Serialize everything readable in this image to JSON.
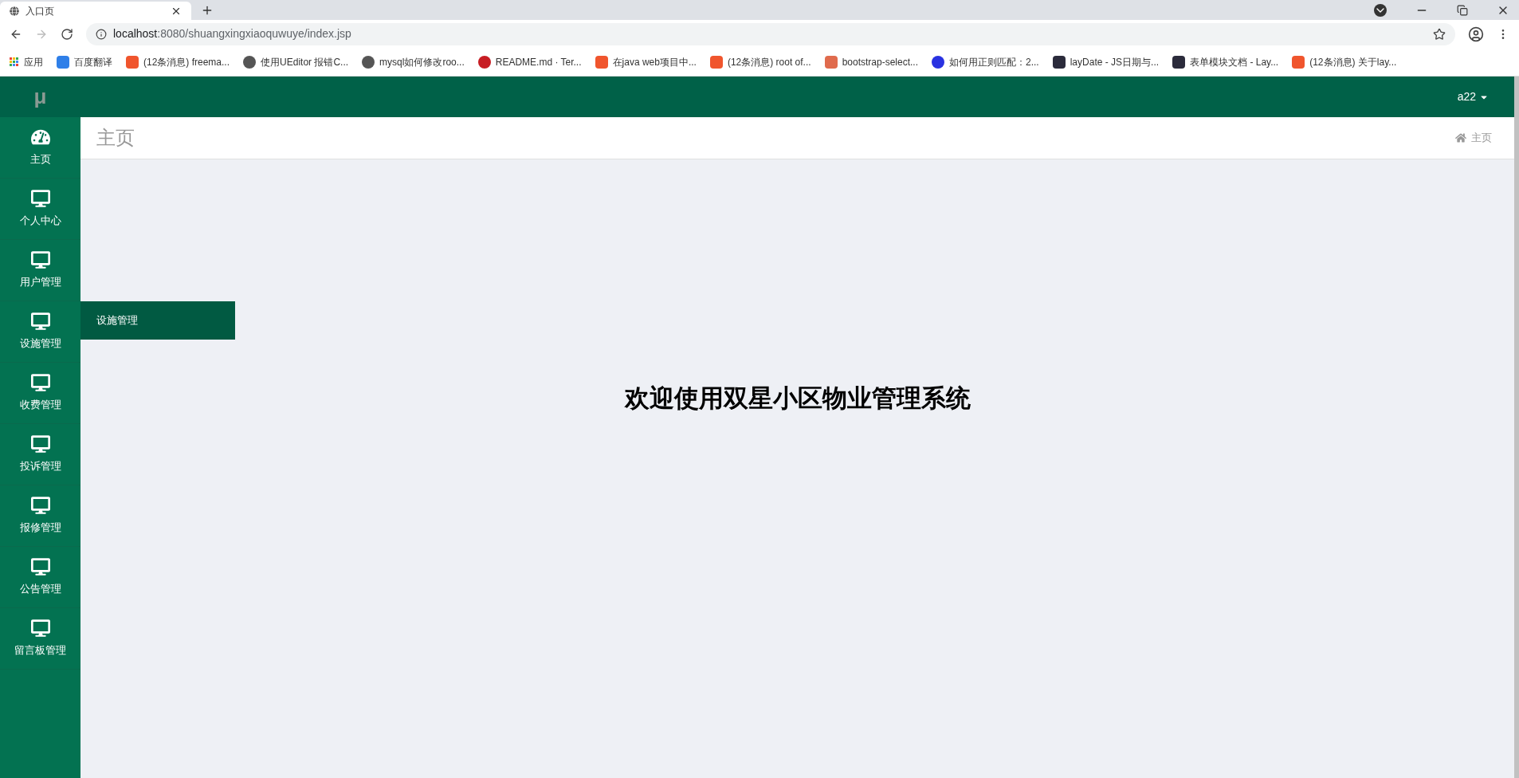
{
  "browser": {
    "tabs": [
      {
        "title": "入口页",
        "selected": true
      }
    ],
    "url_host": "localhost",
    "url_rest": ":8080/shuangxingxiaoquwuye/index.jsp",
    "bookmarks": [
      {
        "label": "应用",
        "kind": "apps"
      },
      {
        "label": "百度翻译",
        "kind": "translate"
      },
      {
        "label": "(12条消息) freema...",
        "kind": "csdn"
      },
      {
        "label": "使用UEditor 报错C...",
        "kind": "plain"
      },
      {
        "label": "mysql如何修改roo...",
        "kind": "plain"
      },
      {
        "label": "README.md · Ter...",
        "kind": "gitee"
      },
      {
        "label": "在java web项目中...",
        "kind": "csdn"
      },
      {
        "label": "(12条消息) root of...",
        "kind": "csdn"
      },
      {
        "label": "bootstrap-select...",
        "kind": "jianshu"
      },
      {
        "label": "如何用正则匹配：2...",
        "kind": "baidu"
      },
      {
        "label": "layDate - JS日期与...",
        "kind": "layui"
      },
      {
        "label": "表单模块文档 - Lay...",
        "kind": "layui"
      },
      {
        "label": "(12条消息) 关于lay...",
        "kind": "csdn"
      }
    ]
  },
  "header": {
    "logo": "μ",
    "user": "a22"
  },
  "sidebar": {
    "items": [
      {
        "label": "主页",
        "kind": "dashboard"
      },
      {
        "label": "个人中心",
        "kind": "desktop"
      },
      {
        "label": "用户管理",
        "kind": "desktop"
      },
      {
        "label": "设施管理",
        "kind": "desktop",
        "children": [
          {
            "label": "设施管理"
          }
        ]
      },
      {
        "label": "收费管理",
        "kind": "desktop"
      },
      {
        "label": "投诉管理",
        "kind": "desktop"
      },
      {
        "label": "报修管理",
        "kind": "desktop"
      },
      {
        "label": "公告管理",
        "kind": "desktop"
      },
      {
        "label": "留言板管理",
        "kind": "desktop"
      }
    ]
  },
  "page_header": {
    "title": "主页",
    "breadcrumb": "主页"
  },
  "welcome": "欢迎使用双星小区物业管理系统"
}
